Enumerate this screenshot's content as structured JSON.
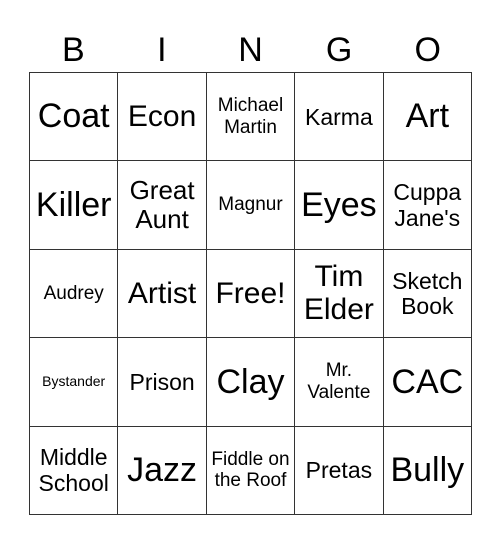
{
  "card": {
    "header": [
      "B",
      "I",
      "N",
      "G",
      "O"
    ],
    "rows": [
      [
        "Coat",
        "Econ",
        "Michael Martin",
        "Karma",
        "Art"
      ],
      [
        "Killer",
        "Great Aunt",
        "Magnur",
        "Eyes",
        "Cuppa Jane's"
      ],
      [
        "Audrey",
        "Artist",
        "Free!",
        "Tim Elder",
        "Sketch Book"
      ],
      [
        "Bystander",
        "Prison",
        "Clay",
        "Mr. Valente",
        "CAC"
      ],
      [
        "Middle School",
        "Jazz",
        "Fiddle on the Roof",
        "Pretas",
        "Bully"
      ]
    ],
    "free_space": "Free!"
  }
}
